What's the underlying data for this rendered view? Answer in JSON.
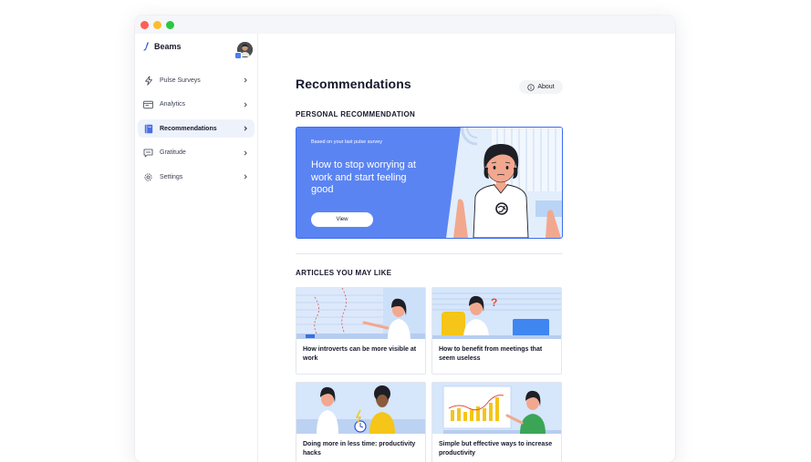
{
  "window": {
    "controls": [
      {
        "name": "close",
        "color": "#ff5f57"
      },
      {
        "name": "minimize",
        "color": "#febc2e"
      },
      {
        "name": "maximize",
        "color": "#28c840"
      }
    ]
  },
  "brand": {
    "name": "Beams",
    "logo_icon": "beams-logo-icon"
  },
  "user": {
    "avatar_icon": "user-avatar"
  },
  "sidebar": {
    "items": [
      {
        "label": "Pulse Surveys",
        "icon": "lightning-icon",
        "active": false
      },
      {
        "label": "Analytics",
        "icon": "analytics-icon",
        "active": false
      },
      {
        "label": "Recommendations",
        "icon": "book-icon",
        "active": true
      },
      {
        "label": "Gratitude",
        "icon": "message-icon",
        "active": false
      },
      {
        "label": "Settings",
        "icon": "gear-icon",
        "active": false
      }
    ]
  },
  "header": {
    "title": "Recommendations",
    "about_label": "About"
  },
  "personal": {
    "section_title": "PERSONAL RECOMMENDATION",
    "subtitle": "Based on your last pulse survey",
    "title": "How to stop worrying at work and start feeling good",
    "button_label": "View"
  },
  "articles": {
    "section_title": "ARTICLES YOU MAY LIKE",
    "items": [
      {
        "title": "How introverts can be more visible at work"
      },
      {
        "title": "How to benefit from meetings that seem useless"
      },
      {
        "title": "Doing more in less time: productivity hacks"
      },
      {
        "title": "Simple but effective ways to increase productivity"
      }
    ]
  },
  "colors": {
    "accent": "#5b84f3",
    "sidebar_active_bg": "#eef2fb",
    "text_primary": "#16182b"
  }
}
